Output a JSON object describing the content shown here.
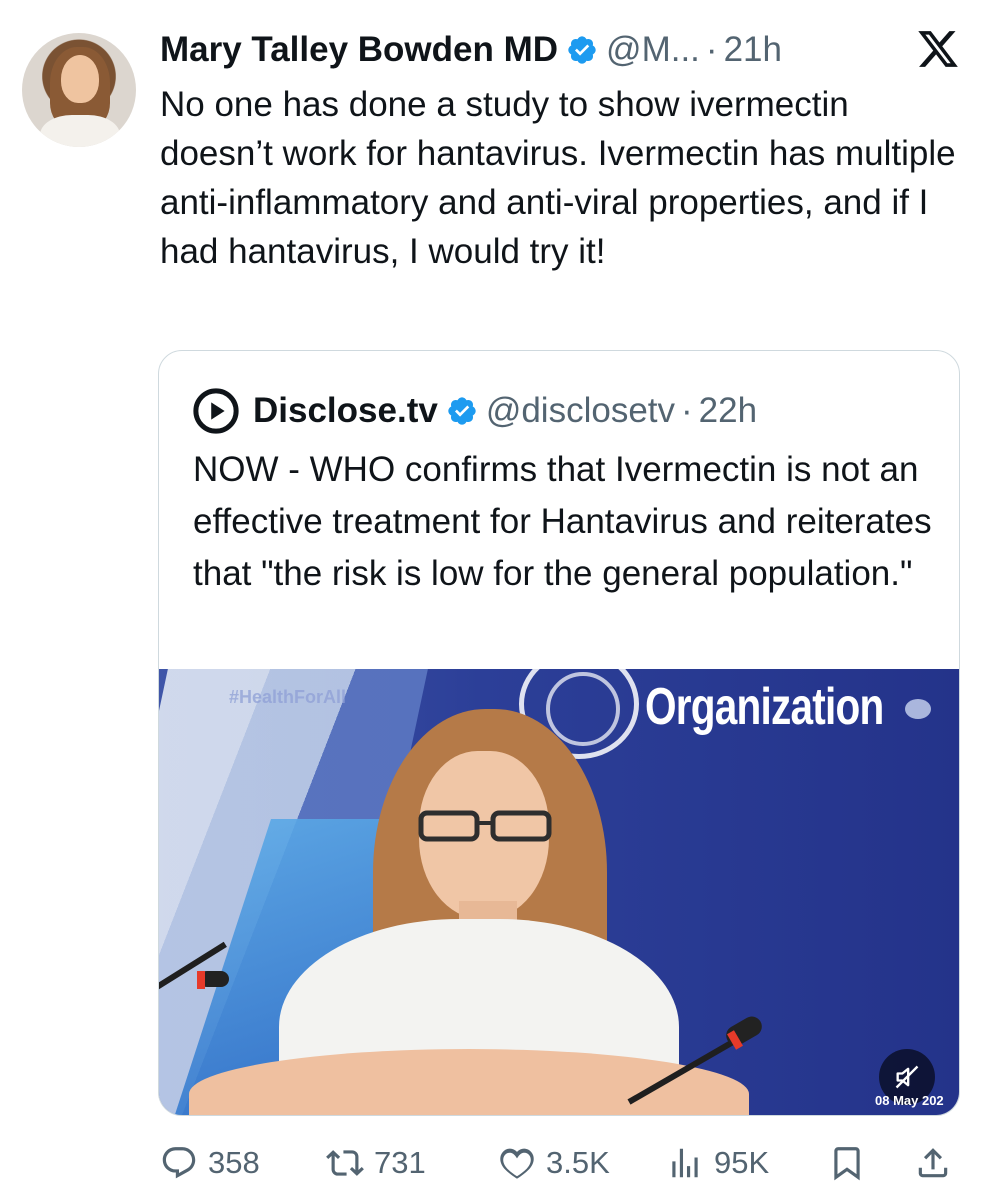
{
  "tweet": {
    "author": {
      "name": "Mary Talley Bowden MD",
      "handle": "@M...",
      "separator": "·",
      "time": "21h",
      "verified_icon": "verified-badge-icon",
      "avatar": "author-avatar"
    },
    "text": "No one has done a study to show ivermectin doesn’t work for hantavirus.  Ivermectin has multiple anti-inflammatory and anti-viral properties, and if I had hantavirus, I would try it!",
    "platform_icon": "x-logo-icon",
    "quote": {
      "author": {
        "name": "Disclose.tv",
        "handle": "@disclosetv",
        "separator": "·",
        "time": "22h",
        "logo": "disclose-tv-logo-icon",
        "verified_icon": "verified-badge-icon"
      },
      "text": "NOW - WHO confirms that Ivermectin is not an effective treatment for Hantavirus and reiterates that \"the risk is low for the general population.\"",
      "media": {
        "type": "video",
        "backdrop_text": "Organization",
        "backdrop_hashtag": "#HealthForAll",
        "date_stamp": "08 May 202",
        "mute_icon": "muted-speaker-icon"
      }
    },
    "actions": {
      "replies": "358",
      "reposts": "731",
      "likes": "3.5K",
      "views": "95K",
      "reply_icon": "reply-icon",
      "repost_icon": "repost-icon",
      "like_icon": "heart-icon",
      "views_icon": "views-chart-icon",
      "bookmark_icon": "bookmark-icon",
      "share_icon": "share-icon"
    },
    "colors": {
      "verified": "#1d9bf0",
      "text": "#0f1419",
      "muted": "#536471",
      "border": "#cfd9de"
    }
  }
}
